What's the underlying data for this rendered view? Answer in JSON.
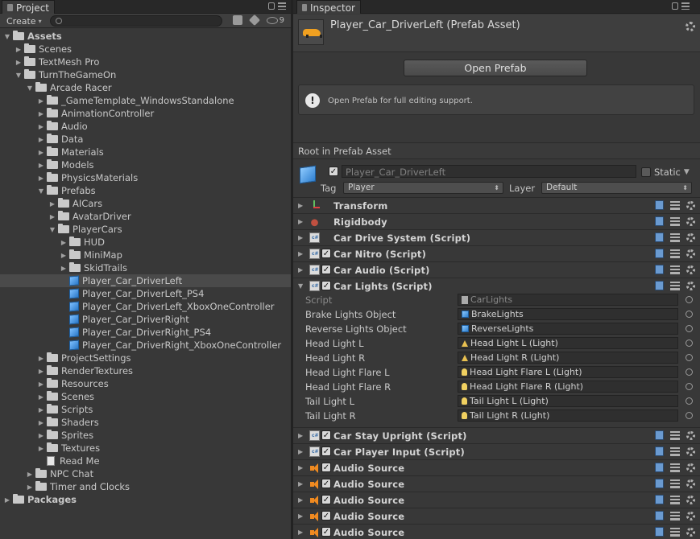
{
  "project": {
    "tab_label": "Project",
    "create_label": "Create",
    "hidden_count": "9",
    "tree": [
      {
        "label": "Assets",
        "depth": 0,
        "icon": "folder",
        "expanded": true,
        "bold": true
      },
      {
        "label": "Scenes",
        "depth": 1,
        "icon": "folder",
        "expanded": false
      },
      {
        "label": "TextMesh Pro",
        "depth": 1,
        "icon": "folder",
        "expanded": false
      },
      {
        "label": "TurnTheGameOn",
        "depth": 1,
        "icon": "folder",
        "expanded": true
      },
      {
        "label": "Arcade Racer",
        "depth": 2,
        "icon": "folder",
        "expanded": true
      },
      {
        "label": "_GameTemplate_WindowsStandalone",
        "depth": 3,
        "icon": "folder",
        "expanded": false
      },
      {
        "label": "AnimationController",
        "depth": 3,
        "icon": "folder",
        "expanded": false
      },
      {
        "label": "Audio",
        "depth": 3,
        "icon": "folder",
        "expanded": false
      },
      {
        "label": "Data",
        "depth": 3,
        "icon": "folder",
        "expanded": false
      },
      {
        "label": "Materials",
        "depth": 3,
        "icon": "folder",
        "expanded": false
      },
      {
        "label": "Models",
        "depth": 3,
        "icon": "folder",
        "expanded": false
      },
      {
        "label": "PhysicsMaterials",
        "depth": 3,
        "icon": "folder",
        "expanded": false
      },
      {
        "label": "Prefabs",
        "depth": 3,
        "icon": "folder",
        "expanded": true
      },
      {
        "label": "AICars",
        "depth": 4,
        "icon": "folder",
        "expanded": false
      },
      {
        "label": "AvatarDriver",
        "depth": 4,
        "icon": "folder",
        "expanded": false
      },
      {
        "label": "PlayerCars",
        "depth": 4,
        "icon": "folder",
        "expanded": true
      },
      {
        "label": "HUD",
        "depth": 5,
        "icon": "folder",
        "expanded": false
      },
      {
        "label": "MiniMap",
        "depth": 5,
        "icon": "folder",
        "expanded": false
      },
      {
        "label": "SkidTrails",
        "depth": 5,
        "icon": "folder",
        "expanded": false
      },
      {
        "label": "Player_Car_DriverLeft",
        "depth": 5,
        "icon": "prefab",
        "selected": true
      },
      {
        "label": "Player_Car_DriverLeft_PS4",
        "depth": 5,
        "icon": "prefab"
      },
      {
        "label": "Player_Car_DriverLeft_XboxOneController",
        "depth": 5,
        "icon": "prefab"
      },
      {
        "label": "Player_Car_DriverRight",
        "depth": 5,
        "icon": "prefab"
      },
      {
        "label": "Player_Car_DriverRight_PS4",
        "depth": 5,
        "icon": "prefab"
      },
      {
        "label": "Player_Car_DriverRight_XboxOneController",
        "depth": 5,
        "icon": "prefab"
      },
      {
        "label": "ProjectSettings",
        "depth": 3,
        "icon": "folder",
        "expanded": false
      },
      {
        "label": "RenderTextures",
        "depth": 3,
        "icon": "folder",
        "expanded": false
      },
      {
        "label": "Resources",
        "depth": 3,
        "icon": "folder",
        "expanded": false
      },
      {
        "label": "Scenes",
        "depth": 3,
        "icon": "folder",
        "expanded": false
      },
      {
        "label": "Scripts",
        "depth": 3,
        "icon": "folder",
        "expanded": false
      },
      {
        "label": "Shaders",
        "depth": 3,
        "icon": "folder",
        "expanded": false
      },
      {
        "label": "Sprites",
        "depth": 3,
        "icon": "folder",
        "expanded": false
      },
      {
        "label": "Textures",
        "depth": 3,
        "icon": "folder",
        "expanded": false
      },
      {
        "label": "Read Me",
        "depth": 3,
        "icon": "doc"
      },
      {
        "label": "NPC Chat",
        "depth": 2,
        "icon": "folder",
        "expanded": false
      },
      {
        "label": "Timer and Clocks",
        "depth": 2,
        "icon": "folder",
        "expanded": false
      },
      {
        "label": "Packages",
        "depth": 0,
        "icon": "folder",
        "expanded": false,
        "bold": true
      }
    ]
  },
  "inspector": {
    "tab_label": "Inspector",
    "title": "Player_Car_DriverLeft (Prefab Asset)",
    "open_prefab_label": "Open Prefab",
    "help_text": "Open Prefab for full editing support.",
    "root_label": "Root in Prefab Asset",
    "object_name": "Player_Car_DriverLeft",
    "static_label": "Static",
    "tag_label": "Tag",
    "tag_value": "Player",
    "layer_label": "Layer",
    "layer_value": "Default",
    "components_top": [
      {
        "name": "Transform",
        "icon": "transform",
        "checkbox": false
      },
      {
        "name": "Rigidbody",
        "icon": "rigid",
        "checkbox": false
      },
      {
        "name": "Car Drive System (Script)",
        "icon": "script",
        "checkbox": false
      },
      {
        "name": "Car Nitro (Script)",
        "icon": "script",
        "checkbox": true
      },
      {
        "name": "Car Audio (Script)",
        "icon": "script",
        "checkbox": true
      },
      {
        "name": "Car Lights (Script)",
        "icon": "script",
        "checkbox": true,
        "expanded": true
      }
    ],
    "car_lights_props": [
      {
        "label": "Script",
        "value": "CarLights",
        "icon": "script",
        "dim": true
      },
      {
        "label": "Brake Lights Object",
        "value": "BrakeLights",
        "icon": "cube"
      },
      {
        "label": "Reverse Lights Object",
        "value": "ReverseLights",
        "icon": "cube"
      },
      {
        "label": "Head Light L",
        "value": "Head Light L (Light)",
        "icon": "light"
      },
      {
        "label": "Head Light R",
        "value": "Head Light R (Light)",
        "icon": "light"
      },
      {
        "label": "Head Light Flare L",
        "value": "Head Light Flare L (Light)",
        "icon": "bulb"
      },
      {
        "label": "Head Light Flare R",
        "value": "Head Light Flare R (Light)",
        "icon": "bulb"
      },
      {
        "label": "Tail Light L",
        "value": "Tail Light L (Light)",
        "icon": "bulb"
      },
      {
        "label": "Tail Light R",
        "value": "Tail Light R (Light)",
        "icon": "bulb"
      }
    ],
    "components_bottom": [
      {
        "name": "Car Stay Upright (Script)",
        "icon": "script",
        "checkbox": true
      },
      {
        "name": "Car Player Input (Script)",
        "icon": "script",
        "checkbox": true
      },
      {
        "name": "Audio Source",
        "icon": "audio",
        "checkbox": true
      },
      {
        "name": "Audio Source",
        "icon": "audio",
        "checkbox": true
      },
      {
        "name": "Audio Source",
        "icon": "audio",
        "checkbox": true
      },
      {
        "name": "Audio Source",
        "icon": "audio",
        "checkbox": true
      },
      {
        "name": "Audio Source",
        "icon": "audio",
        "checkbox": true
      }
    ]
  }
}
